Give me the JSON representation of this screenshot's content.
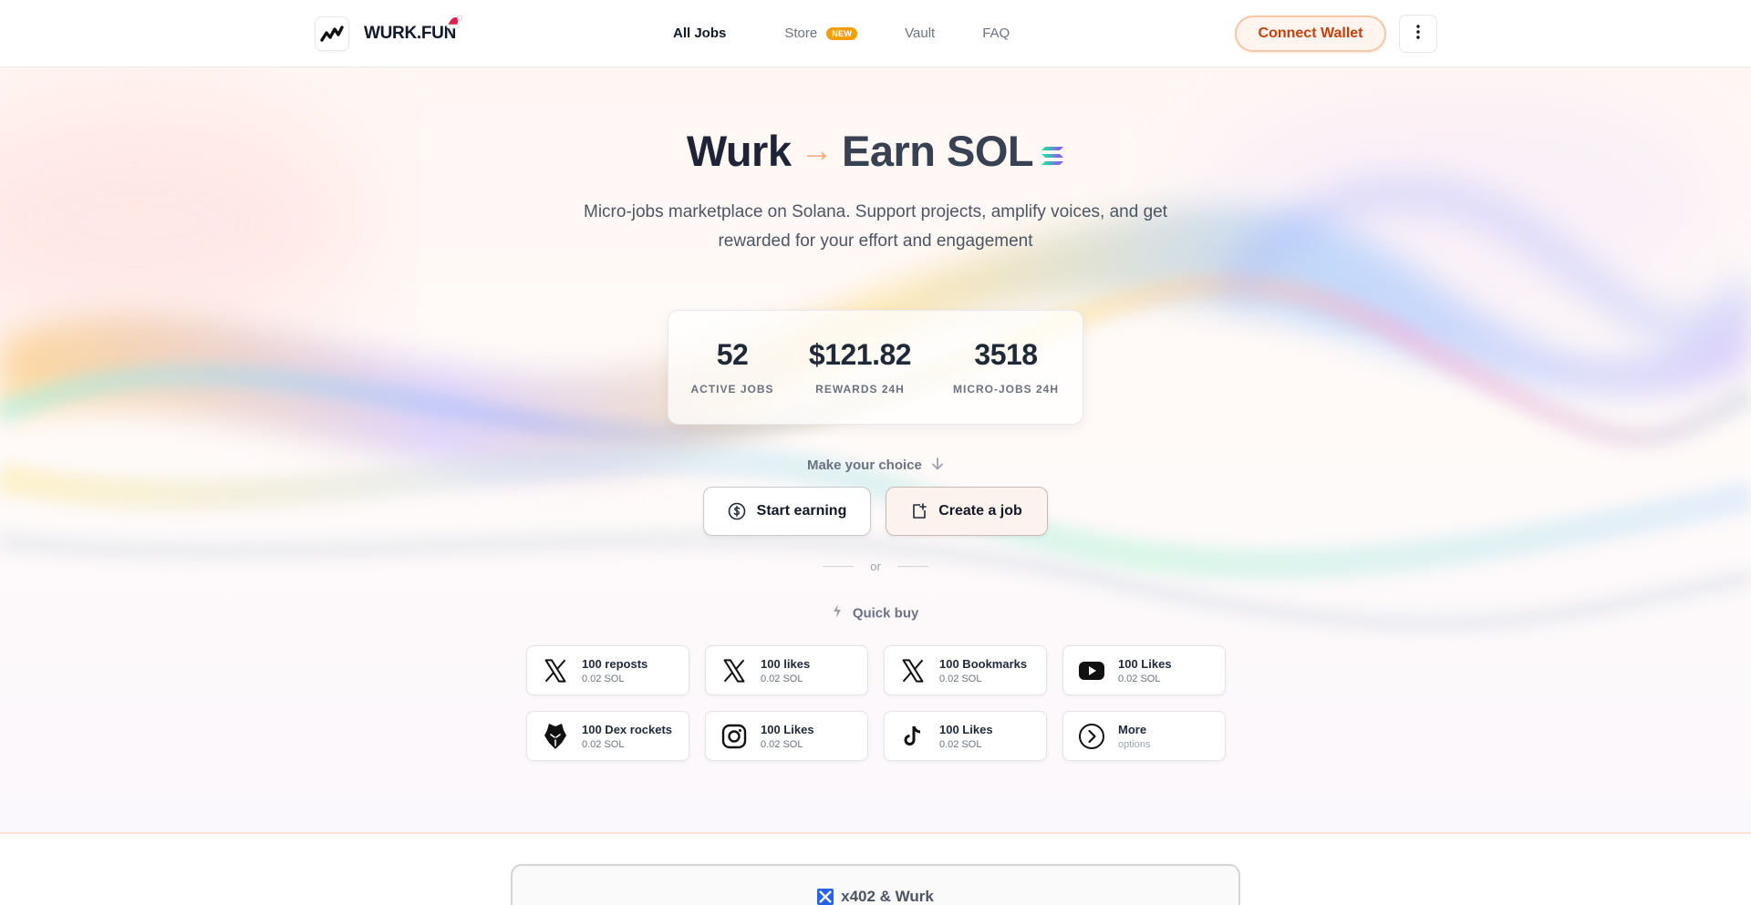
{
  "header": {
    "logo_text": "WURK.FUN",
    "nav": [
      {
        "label": "All Jobs",
        "active": true
      },
      {
        "label": "Store",
        "badge": "NEW"
      },
      {
        "label": "Vault"
      },
      {
        "label": "FAQ"
      }
    ],
    "connect_label": "Connect Wallet"
  },
  "hero": {
    "title_left": "Wurk",
    "title_arrow": "→",
    "title_right": "Earn SOL",
    "subtitle": "Micro-jobs marketplace on Solana. Support projects, amplify voices, and get rewarded for your effort and engagement",
    "stats": [
      {
        "value": "52",
        "label": "ACTIVE JOBS"
      },
      {
        "value": "$121.82",
        "label": "REWARDS 24H"
      },
      {
        "value": "3518",
        "label": "MICRO-JOBS 24H"
      }
    ],
    "choice_label": "Make your choice",
    "start_earning": "Start earning",
    "create_job": "Create a job",
    "or": "or",
    "quick_buy": "Quick buy"
  },
  "quick_buy_items": [
    {
      "title": "100 reposts",
      "sub": "0.02 SOL",
      "icon": "x-logo-icon"
    },
    {
      "title": "100 likes",
      "sub": "0.02 SOL",
      "icon": "x-logo-icon"
    },
    {
      "title": "100 Bookmarks",
      "sub": "0.02 SOL",
      "icon": "x-logo-icon"
    },
    {
      "title": "100 Likes",
      "sub": "0.02 SOL",
      "icon": "youtube-icon"
    },
    {
      "title": "100 Dex rockets",
      "sub": "0.02 SOL",
      "icon": "dexscreener-icon"
    },
    {
      "title": "100 Likes",
      "sub": "0.02 SOL",
      "icon": "instagram-icon"
    },
    {
      "title": "100 Likes",
      "sub": "0.02 SOL",
      "icon": "tiktok-icon"
    },
    {
      "title": "More",
      "sub": "options",
      "icon": "chevron-right-circle-icon"
    }
  ],
  "partner": {
    "title": "x402 & Wurk"
  },
  "colors": {
    "accent": "#c2410c",
    "badge": "#f59e0b",
    "title": "#1e2337"
  }
}
